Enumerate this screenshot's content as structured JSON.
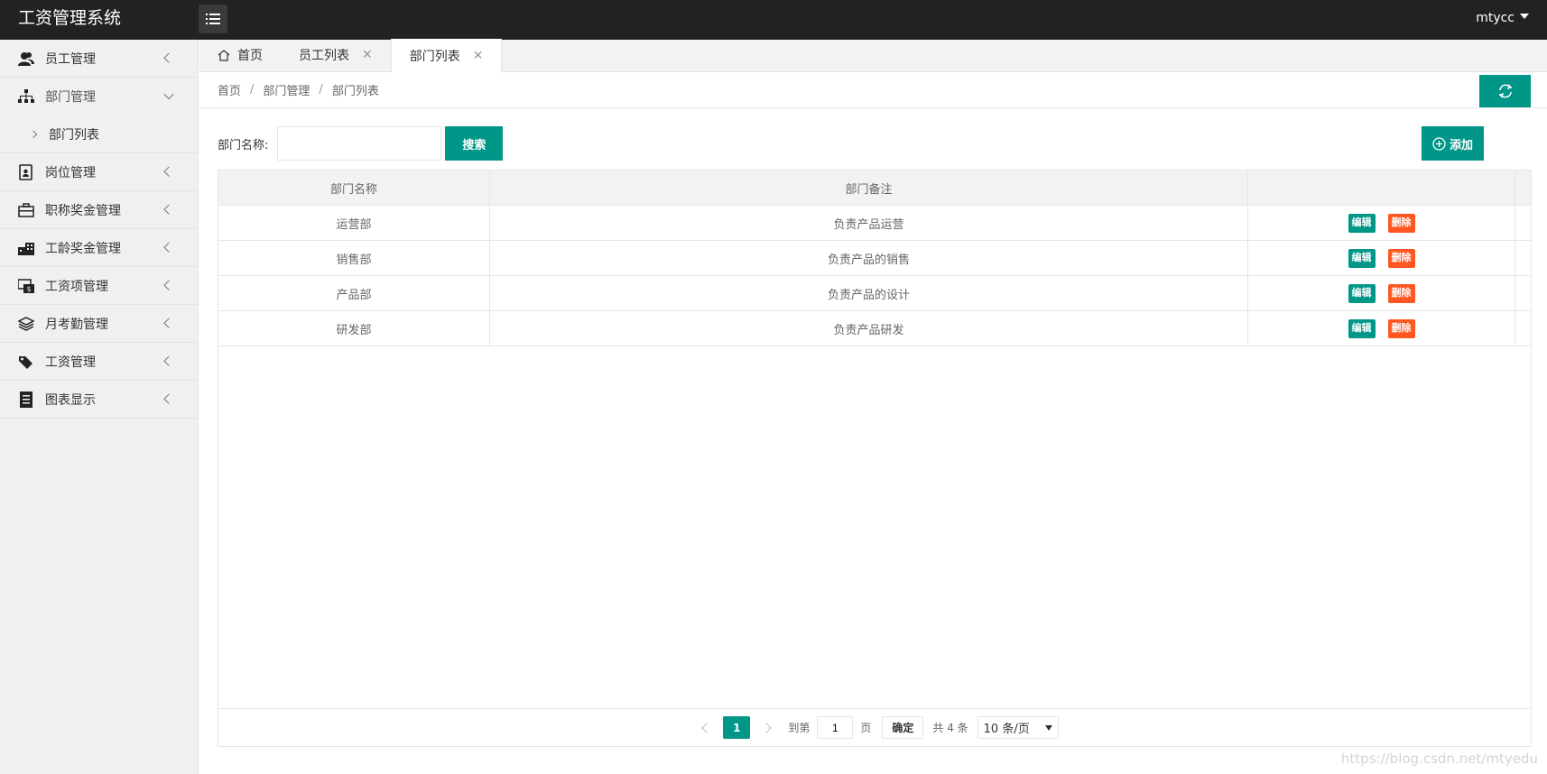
{
  "app": {
    "title": "工资管理系统",
    "user": "mtycc"
  },
  "sidebar": {
    "items": [
      {
        "label": "员工管理",
        "icon": "users-icon"
      },
      {
        "label": "部门管理",
        "icon": "sitemap-icon",
        "sub": "部门列表"
      },
      {
        "label": "岗位管理",
        "icon": "badge-icon"
      },
      {
        "label": "职称奖金管理",
        "icon": "briefcase-icon"
      },
      {
        "label": "工龄奖金管理",
        "icon": "building-icon"
      },
      {
        "label": "工资项管理",
        "icon": "money-icon"
      },
      {
        "label": "月考勤管理",
        "icon": "layers-icon"
      },
      {
        "label": "工资管理",
        "icon": "tags-icon"
      },
      {
        "label": "图表显示",
        "icon": "receipt-icon"
      }
    ]
  },
  "tabs": [
    {
      "label": "首页"
    },
    {
      "label": "员工列表"
    },
    {
      "label": "部门列表"
    }
  ],
  "breadcrumb": [
    "首页",
    "部门管理",
    "部门列表"
  ],
  "search": {
    "label": "部门名称:",
    "value": "",
    "button": "搜索"
  },
  "add_button": "添加",
  "table": {
    "headers": [
      "部门名称",
      "部门备注",
      ""
    ],
    "rows": [
      {
        "name": "运营部",
        "note": "负责产品运营"
      },
      {
        "name": "销售部",
        "note": "负责产品的销售"
      },
      {
        "name": "产品部",
        "note": "负责产品的设计"
      },
      {
        "name": "研发部",
        "note": "负责产品研发"
      }
    ],
    "edit_label": "编辑",
    "delete_label": "删除"
  },
  "pager": {
    "current": "1",
    "goto_label": "到第",
    "goto_value": "1",
    "page_label": "页",
    "confirm": "确定",
    "total": "共 4 条",
    "page_size": "10 条/页"
  },
  "watermark": "https://blog.csdn.net/mtyedu",
  "colors": {
    "accent": "#009688",
    "danger": "#FF5722",
    "header_bg": "#222222"
  }
}
